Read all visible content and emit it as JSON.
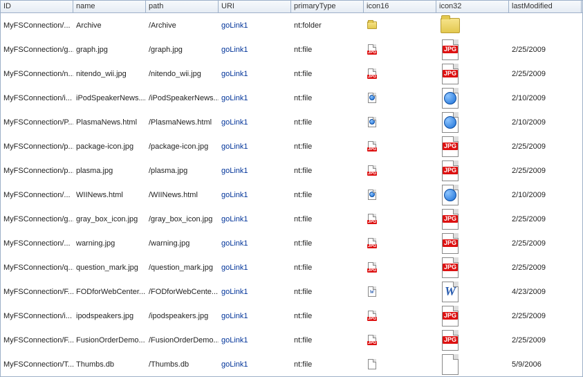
{
  "columns": {
    "id": "ID",
    "name": "name",
    "path": "path",
    "uri": "URI",
    "primaryType": "primaryType",
    "icon16": "icon16",
    "icon32": "icon32",
    "lastModified": "lastModified"
  },
  "uriLinkLabel": "goLink1",
  "fileTypes": {
    "folder": "folder",
    "jpg": "jpg",
    "html": "html",
    "doc": "doc",
    "blank": "blank"
  },
  "rows": [
    {
      "id": "MyFSConnection/...",
      "name": "Archive",
      "path": "/Archive",
      "primaryType": "nt:folder",
      "fileType": "folder",
      "lastModified": ""
    },
    {
      "id": "MyFSConnection/g...",
      "name": "graph.jpg",
      "path": "/graph.jpg",
      "primaryType": "nt:file",
      "fileType": "jpg",
      "lastModified": "2/25/2009"
    },
    {
      "id": "MyFSConnection/n...",
      "name": "nitendo_wii.jpg",
      "path": "/nitendo_wii.jpg",
      "primaryType": "nt:file",
      "fileType": "jpg",
      "lastModified": "2/25/2009"
    },
    {
      "id": "MyFSConnection/i...",
      "name": "iPodSpeakerNews....",
      "path": "/iPodSpeakerNews...",
      "primaryType": "nt:file",
      "fileType": "html",
      "lastModified": "2/10/2009"
    },
    {
      "id": "MyFSConnection/P...",
      "name": "PlasmaNews.html",
      "path": "/PlasmaNews.html",
      "primaryType": "nt:file",
      "fileType": "html",
      "lastModified": "2/10/2009"
    },
    {
      "id": "MyFSConnection/p...",
      "name": "package-icon.jpg",
      "path": "/package-icon.jpg",
      "primaryType": "nt:file",
      "fileType": "jpg",
      "lastModified": "2/25/2009"
    },
    {
      "id": "MyFSConnection/p...",
      "name": "plasma.jpg",
      "path": "/plasma.jpg",
      "primaryType": "nt:file",
      "fileType": "jpg",
      "lastModified": "2/25/2009"
    },
    {
      "id": "MyFSConnection/...",
      "name": "WIINews.html",
      "path": "/WIINews.html",
      "primaryType": "nt:file",
      "fileType": "html",
      "lastModified": "2/10/2009"
    },
    {
      "id": "MyFSConnection/g...",
      "name": "gray_box_icon.jpg",
      "path": "/gray_box_icon.jpg",
      "primaryType": "nt:file",
      "fileType": "jpg",
      "lastModified": "2/25/2009"
    },
    {
      "id": "MyFSConnection/...",
      "name": "warning.jpg",
      "path": "/warning.jpg",
      "primaryType": "nt:file",
      "fileType": "jpg",
      "lastModified": "2/25/2009"
    },
    {
      "id": "MyFSConnection/q...",
      "name": "question_mark.jpg",
      "path": "/question_mark.jpg",
      "primaryType": "nt:file",
      "fileType": "jpg",
      "lastModified": "2/25/2009"
    },
    {
      "id": "MyFSConnection/F...",
      "name": "FODforWebCenter...",
      "path": "/FODforWebCente...",
      "primaryType": "nt:file",
      "fileType": "doc",
      "lastModified": "4/23/2009"
    },
    {
      "id": "MyFSConnection/i...",
      "name": "ipodspeakers.jpg",
      "path": "/ipodspeakers.jpg",
      "primaryType": "nt:file",
      "fileType": "jpg",
      "lastModified": "2/25/2009"
    },
    {
      "id": "MyFSConnection/F...",
      "name": "FusionOrderDemo...",
      "path": "/FusionOrderDemo...",
      "primaryType": "nt:file",
      "fileType": "jpg",
      "lastModified": "2/25/2009"
    },
    {
      "id": "MyFSConnection/T...",
      "name": "Thumbs.db",
      "path": "/Thumbs.db",
      "primaryType": "nt:file",
      "fileType": "blank",
      "lastModified": "5/9/2006"
    }
  ]
}
